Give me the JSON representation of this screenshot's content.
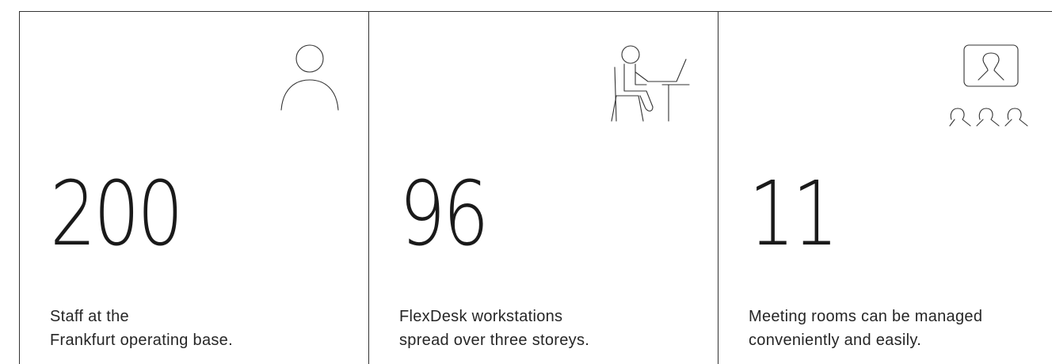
{
  "stats": [
    {
      "value": "200",
      "label_line1": "Staff at the",
      "label_line2": "Frankfurt operating base.",
      "icon": "person-icon"
    },
    {
      "value": "96",
      "label_line1": "FlexDesk workstations",
      "label_line2": "spread over three storeys.",
      "icon": "desk-worker-icon"
    },
    {
      "value": "11",
      "label_line1": "Meeting rooms can be managed",
      "label_line2": "conveniently and easily.",
      "icon": "video-conference-icon"
    }
  ]
}
